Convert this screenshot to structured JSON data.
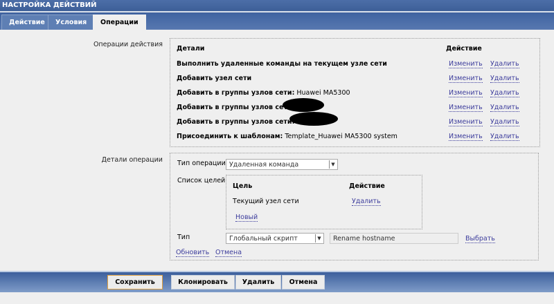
{
  "title": "НАСТРОЙКА ДЕЙСТВИЙ",
  "tabs": [
    "Действие",
    "Условия",
    "Операции"
  ],
  "operations": {
    "label": "Операции действия",
    "col_details": "Детали",
    "col_action": "Действие",
    "rows": [
      {
        "bold": "Выполнить удаленные команды на текущем узле сети",
        "rest": ""
      },
      {
        "bold": "Добавить узел сети",
        "rest": ""
      },
      {
        "bold": "Добавить в группы узлов сети:",
        "rest": " Huawei MA5300"
      },
      {
        "bold": "Добавить в группы узлов сети:",
        "rest": ""
      },
      {
        "bold": "Добавить в группы узлов сети:",
        "rest": ""
      },
      {
        "bold": "Присоединить к шаблонам:",
        "rest": " Template_Huawei MA5300 system"
      }
    ],
    "edit": "Изменить",
    "delete": "Удалить"
  },
  "details": {
    "label": "Детали операции",
    "op_type_label": "Тип операции",
    "op_type_value": "Удаленная команда",
    "targets_label": "Список целей",
    "col_target": "Цель",
    "col_action": "Действие",
    "target": "Текущий узел сети",
    "target_delete": "Удалить",
    "new": "Новый",
    "type_label": "Тип",
    "type_value": "Глобальный скрипт",
    "script": "Rename hostname",
    "choose": "Выбрать",
    "update": "Обновить",
    "cancel": "Отмена"
  },
  "footer": [
    "Сохранить",
    "Клонировать",
    "Удалить",
    "Отмена"
  ]
}
